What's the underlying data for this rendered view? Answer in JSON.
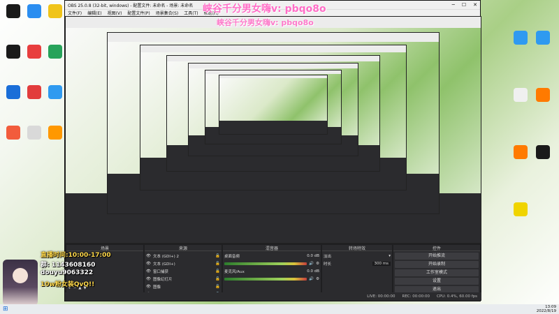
{
  "desktop_icons_left": [
    {
      "label": "",
      "color": "#1a1a1a"
    },
    {
      "label": "",
      "color": "#2b8ef0"
    },
    {
      "label": "",
      "color": "#f0c419"
    },
    {
      "label": "",
      "color": "#1a1a1a"
    },
    {
      "label": "",
      "color": "#e83e3e"
    },
    {
      "label": "",
      "color": "#27a35a"
    },
    {
      "label": "",
      "color": "#1a6ed8"
    },
    {
      "label": "",
      "color": "#e23c3c"
    },
    {
      "label": "",
      "color": "#2f9af0"
    },
    {
      "label": "",
      "color": "#f25c3c"
    },
    {
      "label": "",
      "color": "#d9d9d9"
    },
    {
      "label": "",
      "color": "#ff9800"
    }
  ],
  "desktop_icons_right": [
    {
      "label": "",
      "color": "#2f9af0"
    },
    {
      "label": "",
      "color": "#2f9af0"
    },
    {
      "label": "",
      "color": "#f0f0f0"
    },
    {
      "label": "",
      "color": "#ff7a00"
    },
    {
      "label": "",
      "color": "#ff7a00"
    },
    {
      "label": "",
      "color": "#1a1a1a"
    },
    {
      "label": "",
      "color": "#f0d400"
    }
  ],
  "obs": {
    "title": "OBS 25.0.8 (32-bit, windows) - 配置文件: 未命名 - 场景: 未命名",
    "menus": [
      "文件(F)",
      "编辑(E)",
      "视图(V)",
      "配置文件(P)",
      "场景集合(S)",
      "工具(T)",
      "帮助(H)"
    ],
    "docks": {
      "scenes": {
        "title": "场景"
      },
      "sources": {
        "title": "来源",
        "items": [
          "文本 (GDI+) 2",
          "文本 (GDI+)",
          "窗口捕获",
          "图像幻灯片",
          "图像",
          "视频"
        ]
      },
      "mixer": {
        "title": "混音器",
        "tracks": [
          {
            "label": "桌面音频",
            "db": "0.0 dB"
          },
          {
            "label": "麦克风/Aux",
            "db": "0.0 dB"
          }
        ]
      },
      "transitions": {
        "title": "转场特效",
        "type": "淡出",
        "duration_label": "时长",
        "duration": "300 ms"
      },
      "controls": {
        "title": "控件",
        "buttons": [
          "开始推流",
          "开始录制",
          "工作室模式",
          "设置",
          "退出"
        ]
      }
    },
    "status": {
      "live": "LIVE: 00:00:00",
      "rec": "REC: 00:00:00",
      "cpu": "CPU: 0.4%, 60.00 fps"
    }
  },
  "overlay": {
    "line1": "峡谷千分男女嗨v: pbqo8o",
    "line2": "峡谷千分男女嗨v: pbqo8o"
  },
  "streamer_panel": {
    "header": "直播时间:10:00-17:00",
    "group": "群: 1143608160",
    "douyu": "douyu9063322",
    "fans": "10w粉女装QvQ!!"
  },
  "taskbar": {
    "time": "13:09",
    "date": "2022/8/19"
  }
}
